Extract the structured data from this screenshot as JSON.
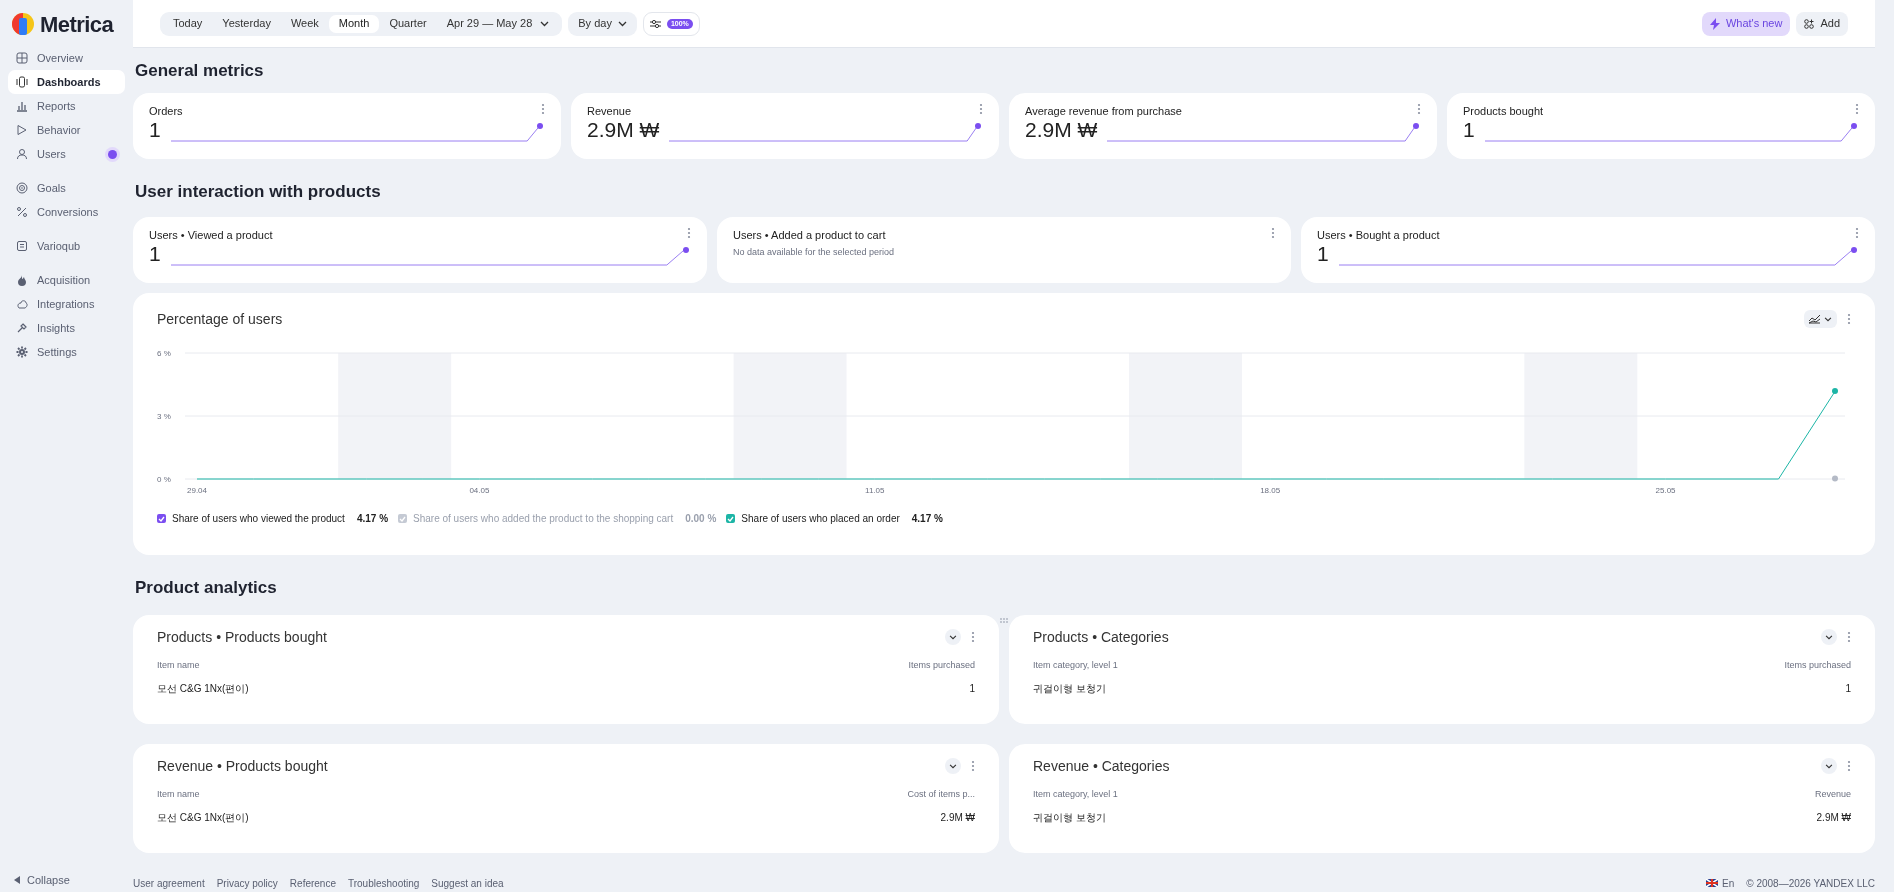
{
  "logo": {
    "name": "Metrica"
  },
  "sidebar": {
    "groups": [
      [
        {
          "label": "Overview",
          "selected": false,
          "badge": false
        },
        {
          "label": "Dashboards",
          "selected": true,
          "badge": false
        },
        {
          "label": "Reports",
          "selected": false,
          "badge": false
        },
        {
          "label": "Behavior",
          "selected": false,
          "badge": false
        },
        {
          "label": "Users",
          "selected": false,
          "badge": true
        }
      ],
      [
        {
          "label": "Goals",
          "selected": false,
          "badge": false
        },
        {
          "label": "Conversions",
          "selected": false,
          "badge": false
        }
      ],
      [
        {
          "label": "Varioqub",
          "selected": false,
          "badge": false
        }
      ],
      [
        {
          "label": "Acquisition",
          "selected": false,
          "badge": false
        },
        {
          "label": "Integrations",
          "selected": false,
          "badge": false
        },
        {
          "label": "Insights",
          "selected": false,
          "badge": false
        },
        {
          "label": "Settings",
          "selected": false,
          "badge": false
        }
      ]
    ],
    "collapse": "Collapse"
  },
  "toolbar": {
    "periods": [
      {
        "label": "Today",
        "selected": false
      },
      {
        "label": "Yesterday",
        "selected": false
      },
      {
        "label": "Week",
        "selected": false
      },
      {
        "label": "Month",
        "selected": true
      },
      {
        "label": "Quarter",
        "selected": false
      }
    ],
    "date_range": "Apr 29 — May 28",
    "grouping": "By day",
    "sampling": "100%",
    "whats_new": "What's new",
    "add": "Add"
  },
  "general_metrics": {
    "title": "General metrics",
    "cards": [
      {
        "title": "Orders",
        "value": "1"
      },
      {
        "title": "Revenue",
        "value": "2.9M ₩"
      },
      {
        "title": "Average revenue from purchase",
        "value": "2.9M ₩"
      },
      {
        "title": "Products bought",
        "value": "1"
      }
    ]
  },
  "user_interaction": {
    "title": "User interaction with products",
    "cards": [
      {
        "title": "Users • Viewed a product",
        "value": "1"
      },
      {
        "title": "Users • Added a product to cart",
        "note": "No data available for the selected period"
      },
      {
        "title": "Users • Bought a product",
        "value": "1"
      }
    ],
    "chart_card": {
      "title": "Percentage of users",
      "chart_data": {
        "type": "line",
        "categories": [
          "29.04",
          null,
          null,
          null,
          null,
          "04.05",
          null,
          null,
          null,
          null,
          null,
          null,
          "11.05",
          null,
          null,
          null,
          null,
          null,
          null,
          "18.05",
          null,
          null,
          null,
          null,
          null,
          null,
          "25.05",
          null,
          null,
          null
        ],
        "yticks": [
          {
            "value": 0,
            "label": "0 %"
          },
          {
            "value": 3,
            "label": "3 %"
          },
          {
            "value": 6,
            "label": "6 %"
          }
        ],
        "ylim": [
          0,
          6
        ],
        "series": [
          {
            "color": "#b4bac6",
            "marker": true,
            "values": [
              null,
              null,
              null,
              null,
              null,
              null,
              null,
              null,
              null,
              null,
              null,
              null,
              null,
              null,
              null,
              null,
              null,
              null,
              null,
              null,
              null,
              null,
              null,
              null,
              null,
              null,
              null,
              null,
              null,
              0
            ]
          },
          {
            "color": "#1cb5a6",
            "marker": true,
            "values": [
              0,
              0,
              0,
              0,
              0,
              0,
              0,
              0,
              0,
              0,
              0,
              0,
              0,
              0,
              0,
              0,
              0,
              0,
              0,
              0,
              0,
              0,
              0,
              0,
              0,
              0,
              0,
              0,
              0,
              4.17
            ]
          }
        ]
      },
      "legend": [
        {
          "label": "Share of users who viewed the product",
          "value": "4.17 %",
          "disabled": false,
          "color": "#7b4ef0"
        },
        {
          "label": "Share of users who added the product to the shopping cart",
          "value": "0.00 %",
          "disabled": true,
          "color": "#c5cad4"
        },
        {
          "label": "Share of users who placed an order",
          "value": "4.17 %",
          "disabled": false,
          "color": "#1cb5a6"
        }
      ]
    }
  },
  "product_analytics": {
    "title": "Product analytics",
    "tables": [
      {
        "title": "Products • Products bought",
        "columns": [
          "Item name",
          "Items purchased"
        ],
        "rows": [
          [
            "모선 C&G 1Nx(편이)",
            "1"
          ]
        ]
      },
      {
        "title": "Products • Categories",
        "columns": [
          "Item category, level 1",
          "Items purchased"
        ],
        "rows": [
          [
            "귀걸이형 보청기",
            "1"
          ]
        ]
      },
      {
        "title": "Revenue • Products bought",
        "columns": [
          "Item name",
          "Cost of items p..."
        ],
        "rows": [
          [
            "모선 C&G 1Nx(편이)",
            "2.9M ₩"
          ]
        ]
      },
      {
        "title": "Revenue • Categories",
        "columns": [
          "Item category, level 1",
          "Revenue"
        ],
        "rows": [
          [
            "귀걸이형 보청기",
            "2.9M ₩"
          ]
        ]
      }
    ]
  },
  "footer": {
    "links": [
      "User agreement",
      "Privacy policy",
      "Reference",
      "Troubleshooting",
      "Suggest an idea"
    ],
    "language": "En",
    "copyright": "© 2008—2026 YANDEX LLC"
  }
}
